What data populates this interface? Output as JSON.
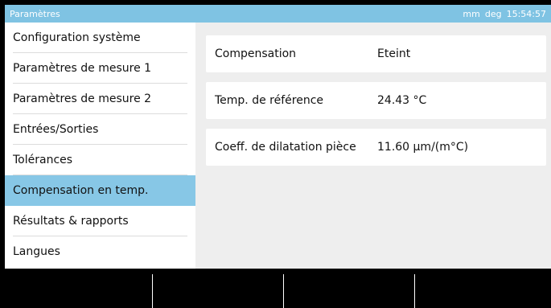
{
  "titlebar": {
    "title": "Paramètres",
    "units_length": "mm",
    "units_angle": "deg",
    "time": "15:54:57"
  },
  "sidebar": {
    "items": [
      {
        "label": "Configuration système"
      },
      {
        "label": "Paramètres de mesure 1"
      },
      {
        "label": "Paramètres de mesure 2"
      },
      {
        "label": "Entrées/Sorties"
      },
      {
        "label": "Tolérances"
      },
      {
        "label": "Compensation en temp.",
        "active": true
      },
      {
        "label": "Résultats & rapports"
      },
      {
        "label": "Langues"
      }
    ]
  },
  "main": {
    "rows": [
      {
        "label": "Compensation",
        "value": "Eteint"
      },
      {
        "label": "Temp. de référence",
        "value": "24.43 °C"
      },
      {
        "label": "Coeff. de dilatation pièce",
        "value": "11.60 µm/(m°C)"
      }
    ]
  },
  "colors": {
    "accent": "#87c7e6",
    "titlebar": "#7fc3e3",
    "content_bg": "#eeeeee"
  }
}
